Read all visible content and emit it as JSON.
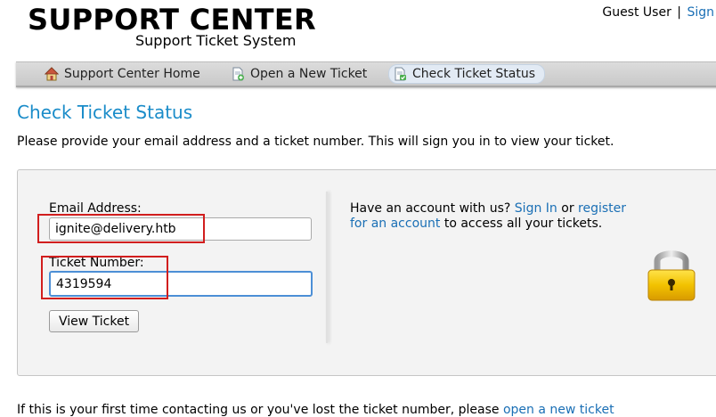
{
  "header": {
    "logo_title": "SUPPORT CENTER",
    "logo_subtitle": "Support Ticket System",
    "user_label": "Guest User",
    "separator": "|",
    "sign_in": "Sign"
  },
  "nav": {
    "items": [
      {
        "label": "Support Center Home",
        "icon": "home-icon"
      },
      {
        "label": "Open a New Ticket",
        "icon": "new-ticket-icon"
      },
      {
        "label": "Check Ticket Status",
        "icon": "ticket-status-icon",
        "active": true
      }
    ]
  },
  "main": {
    "title": "Check Ticket Status",
    "intro": "Please provide your email address and a ticket number. This will sign you in to view your ticket."
  },
  "form": {
    "email_label": "Email Address:",
    "email_value": "ignite@delivery.htb",
    "ticket_label": "Ticket Number:",
    "ticket_value": "4319594",
    "submit_label": "View Ticket"
  },
  "account": {
    "prefix": "Have an account with us?",
    "sign_in": "Sign In",
    "or": "or",
    "register": "register for an account",
    "suffix": "to access all your tickets."
  },
  "footer": {
    "text": "If this is your first time contacting us or you've lost the ticket number, please",
    "link": "open a new ticket"
  },
  "colors": {
    "link": "#1a6fb5",
    "title": "#1a8cc9",
    "highlight": "#d11e1e",
    "lock_body": "#f2c200"
  }
}
